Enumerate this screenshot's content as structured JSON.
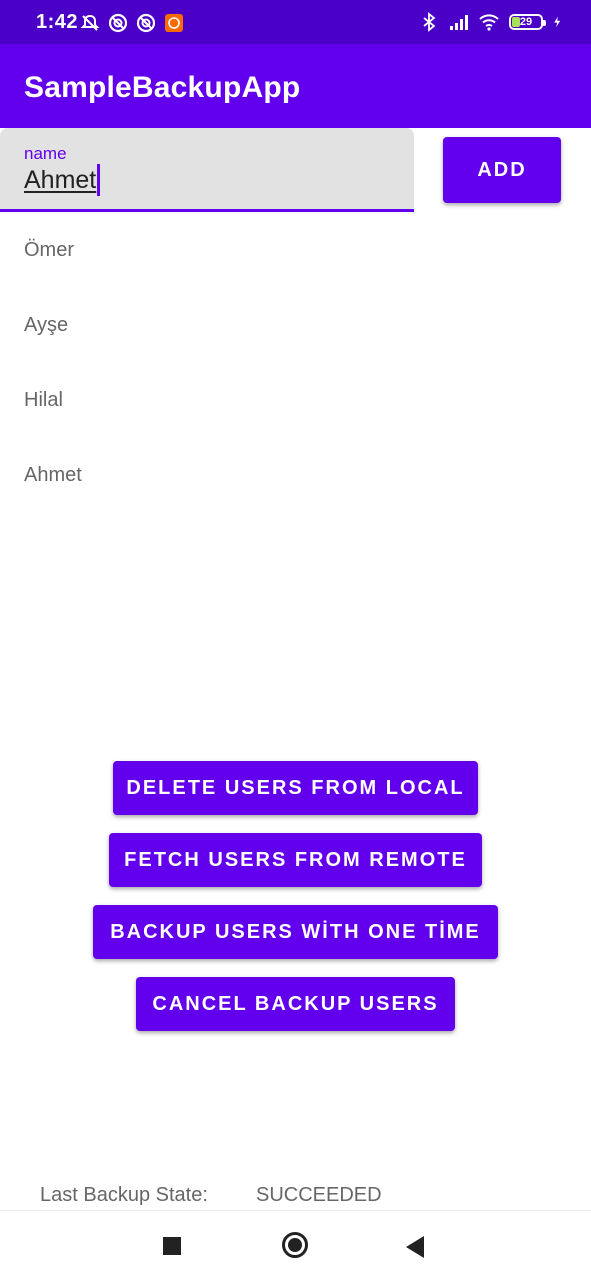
{
  "status_bar": {
    "time": "1:42",
    "battery_level": "29",
    "battery_fraction": 0.29,
    "left_icons": [
      "bell-off-icon",
      "do-not-disturb-icon",
      "do-not-disturb-icon",
      "mi-app-icon"
    ],
    "right_icons": [
      "bluetooth-icon",
      "signal-icon",
      "wifi-icon",
      "battery-icon",
      "charging-icon"
    ]
  },
  "app_bar": {
    "title": "SampleBackupApp"
  },
  "name_field": {
    "label": "name",
    "value": "Ahmet"
  },
  "add_button": {
    "label": "ADD"
  },
  "users": [
    "Ömer",
    "Ayşe",
    "Hilal",
    "Ahmet"
  ],
  "actions": {
    "delete_local": "DELETE USERS FROM LOCAL",
    "fetch_remote": "FETCH USERS FROM REMOTE",
    "backup_one_time": "BACKUP USERS WİTH ONE TİME",
    "cancel_backup": "CANCEL BACKUP USERS"
  },
  "backup_state": {
    "label": "Last Backup State:",
    "value": "SUCCEEDED"
  },
  "nav_bar": {
    "icons": [
      "recents-icon",
      "home-icon",
      "back-icon"
    ]
  },
  "colors": {
    "primary": "#6200ee",
    "primary_dark": "#4a00c7",
    "battery_fill": "#a6e25b"
  }
}
